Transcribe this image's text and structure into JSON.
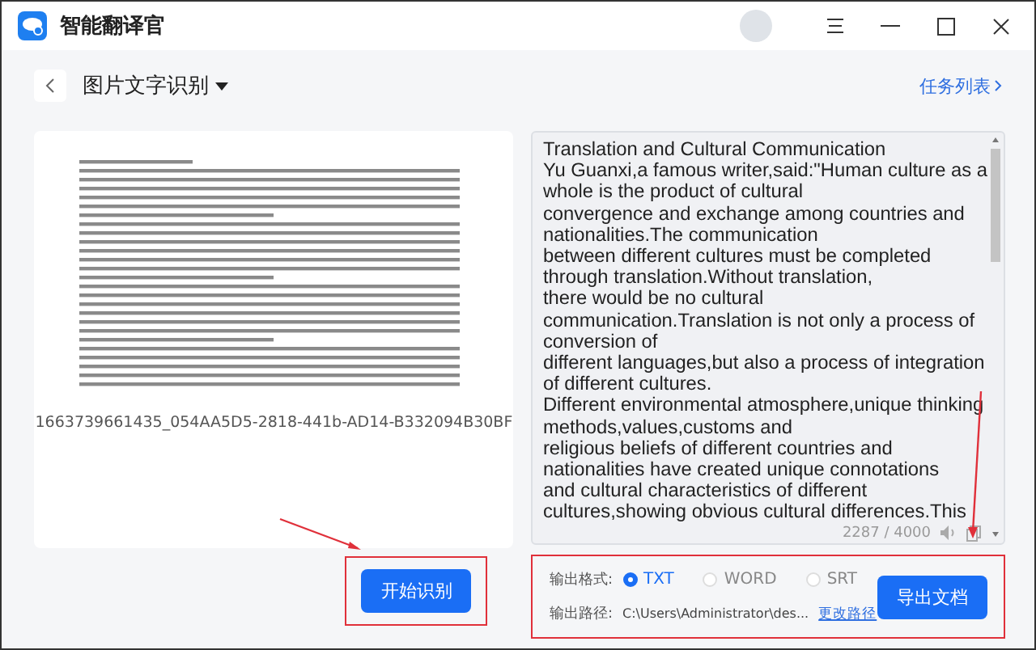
{
  "window": {
    "app_name": "智能翻译官"
  },
  "header": {
    "title": "图片文字识别",
    "task_list": "任务列表"
  },
  "source": {
    "file_name": "1663739661435_054AA5D5-2818-441b-AD14-B332094B30BF",
    "start_button": "开始识别"
  },
  "result": {
    "text": "Translation and Cultural Communication\nYu Guanxi,a famous writer,said:\"Human culture as a\nwhole is the product of cultural\nconvergence and exchange among countries and\nnationalities.The communication\nbetween different cultures must be completed\nthrough translation.Without translation,\nthere would be no cultural\ncommunication.Translation is not only a process of\nconversion of\ndifferent languages,but also a process of integration\nof different cultures.\nDifferent environmental atmosphere,unique thinking\nmethods,values,customs and\nreligious beliefs of different countries and\nnationalities have created unique connotations\nand cultural characteristics of different\ncultures,showing obvious cultural differences.This",
    "counter": "2287 / 4000"
  },
  "export": {
    "format_label": "输出格式:",
    "formats": [
      {
        "label": "TXT",
        "selected": true
      },
      {
        "label": "WORD",
        "selected": false
      },
      {
        "label": "SRT",
        "selected": false
      }
    ],
    "path_label": "输出路径:",
    "path": "C:\\Users\\Administrator\\des...",
    "change_path": "更改路径",
    "export_button": "导出文档"
  }
}
